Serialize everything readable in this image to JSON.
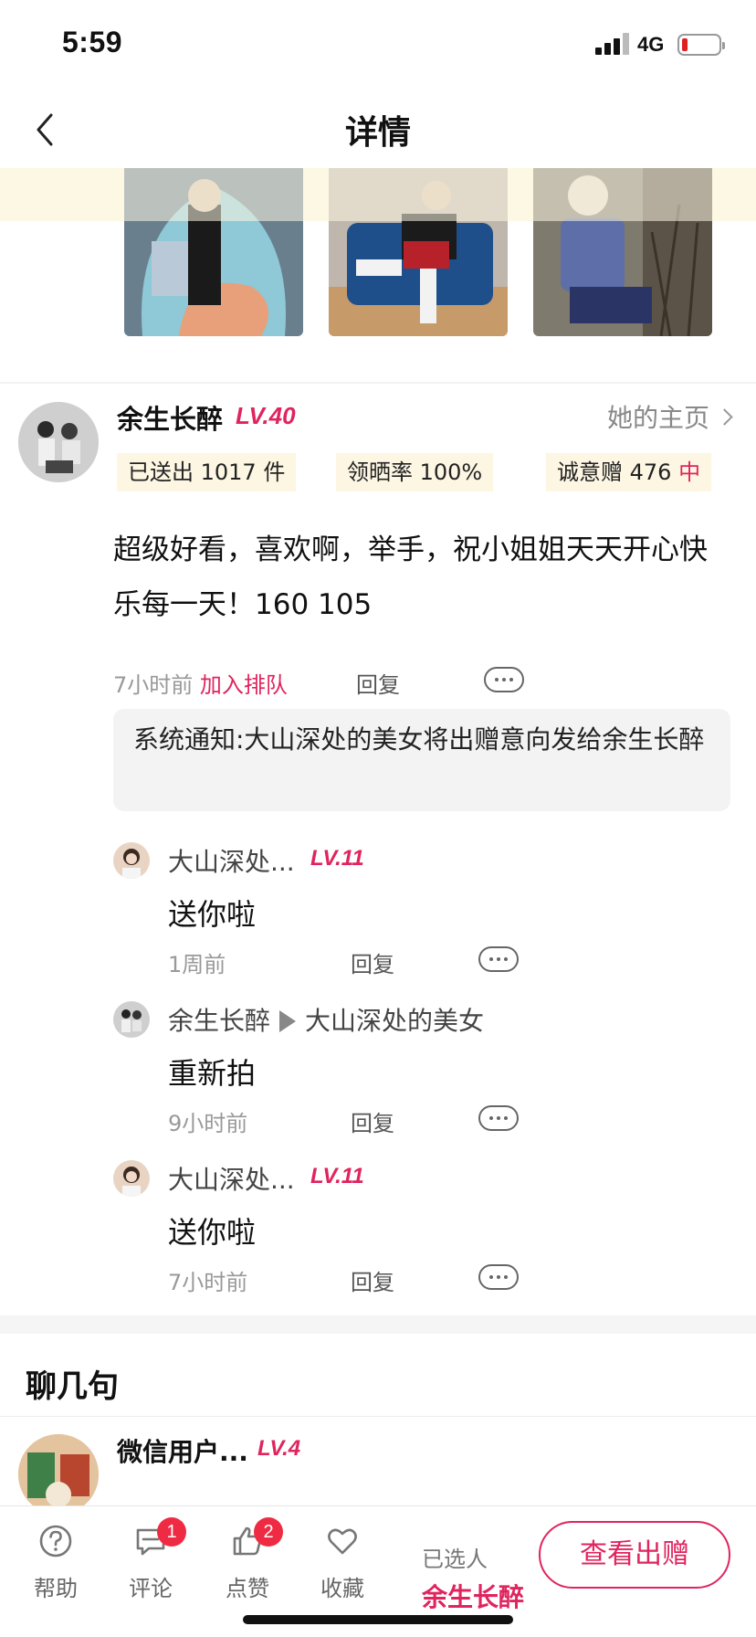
{
  "status_bar": {
    "time": "5:59",
    "network": "4G"
  },
  "header": {
    "title": "详情"
  },
  "main_comment": {
    "username": "余生长醉",
    "level": "LV.40",
    "homepage_link": "她的主页",
    "stats": {
      "sent": "已送出 1017 件",
      "claim_rate": "领晒率 100%",
      "sincerity_prefix": "诚意赠 476 ",
      "sincerity_suffix": "中"
    },
    "text": "超级好看，喜欢啊，举手，祝小姐姐天天开心快乐每一天！160 105",
    "time": "7小时前",
    "join_queue": "加入排队",
    "reply_label": "回复"
  },
  "system_notice": "系统通知:大山深处的美女将出赠意向发给余生长醉",
  "replies": [
    {
      "name": "大山深处...",
      "level": "LV.11",
      "text": "送你啦",
      "time": "1周前",
      "reply_label": "回复"
    },
    {
      "name": "余生长醉",
      "target": "大山深处的美女",
      "text": "重新拍",
      "time": "9小时前",
      "reply_label": "回复"
    },
    {
      "name": "大山深处...",
      "level": "LV.11",
      "text": "送你啦",
      "time": "7小时前",
      "reply_label": "回复"
    }
  ],
  "chat_section": {
    "title": "聊几句",
    "first_user": {
      "name": "微信用户...",
      "level": "LV.4"
    }
  },
  "bottom_bar": {
    "tabs": [
      {
        "label": "帮助",
        "icon": "help-icon"
      },
      {
        "label": "评论",
        "icon": "comment-icon",
        "badge": "1"
      },
      {
        "label": "点赞",
        "icon": "thumbs-up-icon",
        "badge": "2"
      },
      {
        "label": "收藏",
        "icon": "heart-icon"
      }
    ],
    "selected_label": "已选人",
    "selected_name": "余生长醉",
    "view_button": "查看出赠"
  },
  "colors": {
    "accent": "#e0245e",
    "badge": "#ef2b43",
    "stat_bg": "#fdf6e3"
  }
}
